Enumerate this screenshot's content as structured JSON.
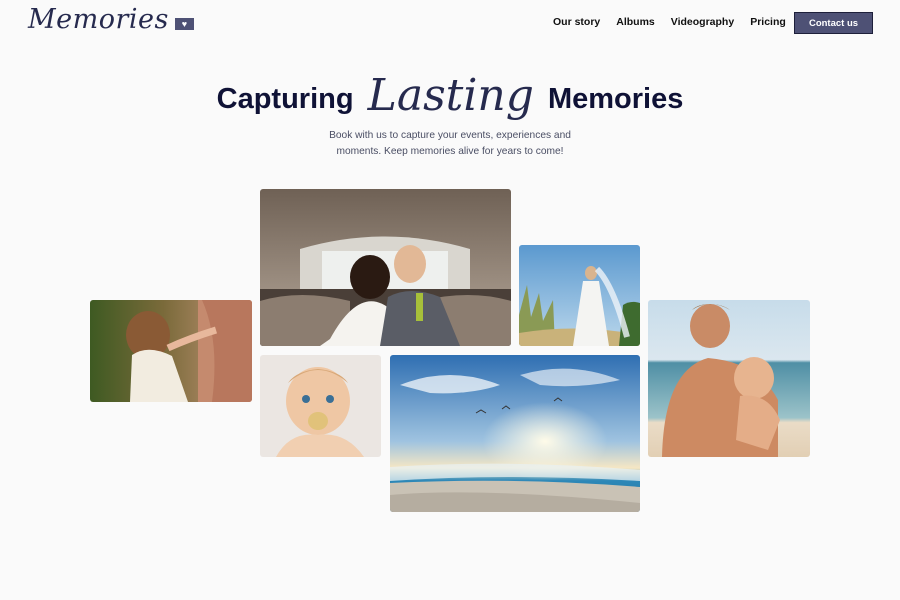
{
  "brand": {
    "name": "Memories",
    "badge_icon": "heart-icon"
  },
  "nav": {
    "items": [
      {
        "label": "Our story"
      },
      {
        "label": "Albums"
      },
      {
        "label": "Videography"
      },
      {
        "label": "Pricing"
      }
    ],
    "contact_label": "Contact us"
  },
  "hero": {
    "title_before": "Capturing",
    "title_script": "Lasting",
    "title_after": "Memories",
    "subtitle_line1": "Book with us to capture your events, experiences and",
    "subtitle_line2": "moments. Keep memories alive for years to come!"
  },
  "colors": {
    "page_bg": "#fafafa",
    "heading": "#0f1236",
    "accent": "#4e5175",
    "body_text": "#4a4e64"
  }
}
